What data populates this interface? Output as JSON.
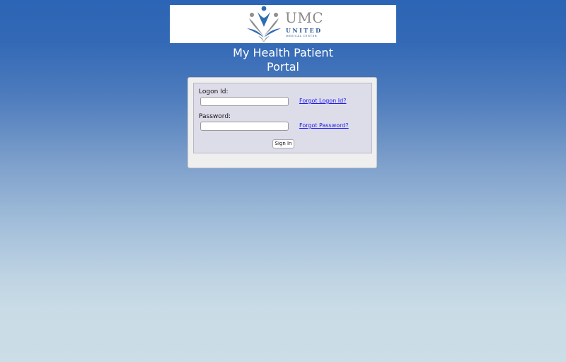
{
  "header": {
    "logo": {
      "name": "UMC",
      "subtitle": "UNITED",
      "tagline": "MEDICAL CENTER"
    },
    "portal_title_line1": "My Health Patient",
    "portal_title_line2": "Portal"
  },
  "login": {
    "logon_id_label": "Logon Id:",
    "logon_id_value": "",
    "password_label": "Password:",
    "password_value": "",
    "forgot_logon_link": "Forgot Logon Id?",
    "forgot_password_link": "Forgot Password?",
    "sign_in_label": "Sign In"
  },
  "colors": {
    "brand_blue": "#2c65b5",
    "logo_blue": "#2d5a96",
    "logo_gray": "#8a8a8a",
    "link": "#1a1aee",
    "panel_inner": "#dddce9"
  },
  "icons": {
    "logo_mark": "umc-people-logo-icon"
  }
}
